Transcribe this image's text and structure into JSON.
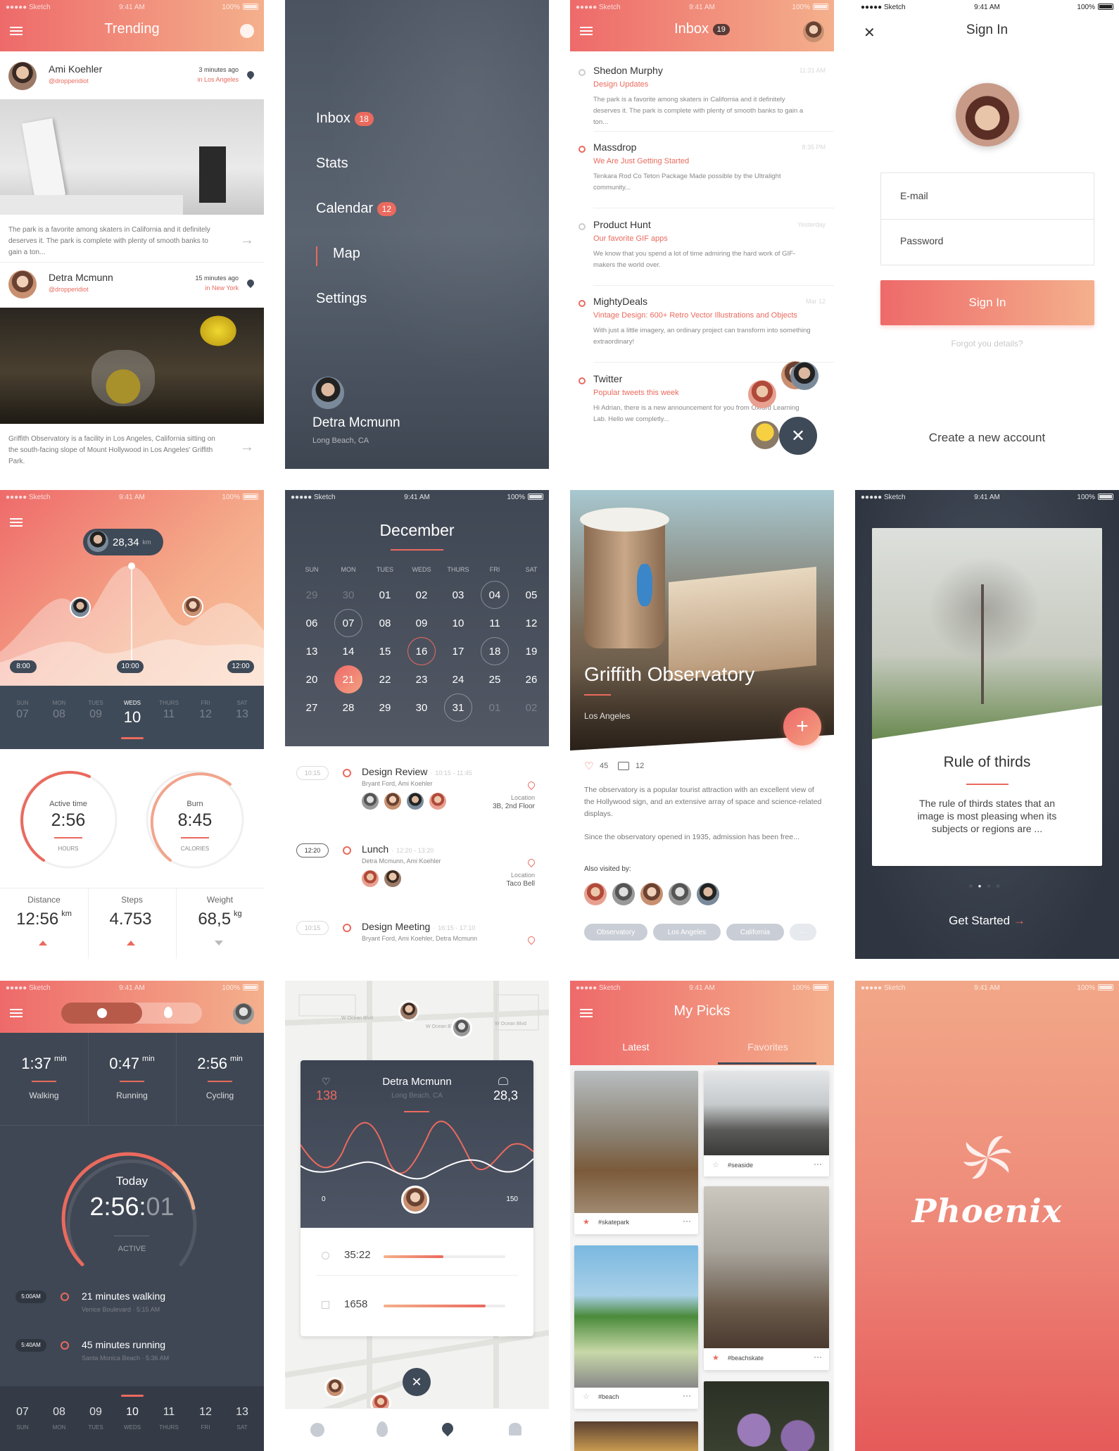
{
  "status": {
    "carrier": "●●●●● Sketch",
    "time": "9:41 AM",
    "battery": "100%"
  },
  "trending": {
    "title": "Trending",
    "posts": [
      {
        "name": "Ami Koehler",
        "handle": "@dropperidiot",
        "time": "3 minutes ago",
        "location": "in Los Angeles",
        "text": "The park is a favorite among skaters in California and it definitely deserves it. The park is complete with plenty of smooth banks to gain a ton..."
      },
      {
        "name": "Detra Mcmunn",
        "handle": "@dropperidiot",
        "time": "15 minutes ago",
        "location": "in New York",
        "text": "Griffith Observatory is a facility in Los Angeles, California sitting on the south-facing slope of Mount Hollywood in Los Angeles' Griffith Park."
      }
    ]
  },
  "menu": {
    "items": [
      {
        "label": "Inbox",
        "badge": "18"
      },
      {
        "label": "Stats",
        "badge": ""
      },
      {
        "label": "Calendar",
        "badge": "12"
      },
      {
        "label": "Map",
        "badge": ""
      },
      {
        "label": "Settings",
        "badge": ""
      }
    ],
    "user_name": "Detra Mcmunn",
    "user_location": "Long Beach, CA"
  },
  "inbox": {
    "title": "Inbox",
    "badge": "19",
    "messages": [
      {
        "sender": "Shedon Murphy",
        "time": "11:31 AM",
        "subject": "Design Updates",
        "preview": "The park is a favorite among skaters in California and it definitely deserves it. The park is complete with plenty of smooth banks to gain a ton..."
      },
      {
        "sender": "Massdrop",
        "time": "8:35 PM",
        "subject": "We Are Just Getting Started",
        "preview": "Tenkara Rod Co Teton Package Made possible by the Ultralight community..."
      },
      {
        "sender": "Product Hunt",
        "time": "Yesterday",
        "subject": "Our favorite GIF apps",
        "preview": "We know that you spend a lot of time admiring the hard work of GIF-makers the world over."
      },
      {
        "sender": "MightyDeals",
        "time": "Mar 12",
        "subject": "Vintage Design: 600+ Retro Vector Illustrations and Objects",
        "preview": "With just a little imagery, an ordinary project can transform into something extraordinary!"
      },
      {
        "sender": "Twitter",
        "time": "",
        "subject": "Popular tweets this week",
        "preview": "Hi Adrian, there is a new announcement for you from Oxford Learning  Lab. Hello we completly..."
      }
    ]
  },
  "signin": {
    "title": "Sign In",
    "email_placeholder": "E-mail",
    "password_placeholder": "Password",
    "button": "Sign In",
    "forgot": "Forgot you details?",
    "create": "Create a new account"
  },
  "activity": {
    "bubble_value": "28,34",
    "bubble_unit": "km",
    "time_labels": [
      "8:00",
      "10:00",
      "12:00"
    ],
    "days": [
      {
        "name": "SUN",
        "num": "07"
      },
      {
        "name": "MON",
        "num": "08"
      },
      {
        "name": "TUES",
        "num": "09"
      },
      {
        "name": "WEDS",
        "num": "10"
      },
      {
        "name": "THURS",
        "num": "11"
      },
      {
        "name": "FRI",
        "num": "12"
      },
      {
        "name": "SAT",
        "num": "13"
      }
    ],
    "active_time_label": "Active time",
    "active_time": "2:56",
    "active_time_unit": "HOURS",
    "burn_label": "Burn",
    "burn": "8:45",
    "burn_unit": "CALORIES",
    "stats": [
      {
        "label": "Distance",
        "value": "12:56",
        "unit": "km"
      },
      {
        "label": "Steps",
        "value": "4.753",
        "unit": ""
      },
      {
        "label": "Weight",
        "value": "68,5",
        "unit": "kg"
      }
    ]
  },
  "calendar": {
    "month": "December",
    "weekdays": [
      "SUN",
      "MON",
      "TUES",
      "WEDS",
      "THURS",
      "FRI",
      "SAT"
    ],
    "weeks": [
      [
        "29",
        "30",
        "01",
        "02",
        "03",
        "04",
        "05"
      ],
      [
        "06",
        "07",
        "08",
        "09",
        "10",
        "11",
        "12"
      ],
      [
        "13",
        "14",
        "15",
        "16",
        "17",
        "18",
        "19"
      ],
      [
        "20",
        "21",
        "22",
        "23",
        "24",
        "25",
        "26"
      ],
      [
        "27",
        "28",
        "29",
        "30",
        "31",
        "01",
        "02"
      ]
    ],
    "events": [
      {
        "time": "10:15",
        "title": "Design Review",
        "range": "10:15 - 11:45",
        "people": "Bryant Ford, Ami Koehler",
        "loc_label": "Location",
        "loc": "3B, 2nd Floor"
      },
      {
        "time": "12:20",
        "title": "Lunch",
        "range": "12:20 - 13:20",
        "people": "Detra Mcmunn, Ami Koehler",
        "loc_label": "Location",
        "loc": "Taco Bell"
      },
      {
        "time": "10:15",
        "title": "Design Meeting",
        "range": "16:15 - 17:10",
        "people": "Bryant Ford, Ami Koehler, Detra Mcmunn",
        "loc_label": "",
        "loc": ""
      }
    ]
  },
  "place": {
    "title": "Griffith Observatory",
    "subtitle": "Los Angeles",
    "likes": "45",
    "comments": "12",
    "desc1": "The observatory is a popular tourist attraction with an excellent view of the Hollywood sign, and an extensive array of space and science-related displays.",
    "desc2": "Since the observatory opened in 1935, admission has been free...",
    "visited_label": "Also visited by:",
    "tags": [
      "Observatory",
      "Los Angeles",
      "California",
      "···"
    ]
  },
  "onboarding": {
    "title": "Rule of thirds",
    "text": "The rule of thirds states that an image is most pleasing when its subjects or regions are ...",
    "cta": "Get Started"
  },
  "timer": {
    "stats": [
      {
        "value": "1:37",
        "unit": "min",
        "label": "Walking"
      },
      {
        "value": "0:47",
        "unit": "min",
        "label": "Running"
      },
      {
        "value": "2:56",
        "unit": "min",
        "label": "Cycling"
      }
    ],
    "today": "Today",
    "time_main": "2:56:",
    "time_sec": "01",
    "active": "ACTIVE",
    "timeline": [
      {
        "time": "5:00AM",
        "title": "21 minutes walking",
        "sub": "Venice Boulevard  ·  5:15 AM"
      },
      {
        "time": "5:40AM",
        "title": "45 minutes running",
        "sub": "Santa Monica Beach  ·  5:36 AM"
      }
    ],
    "days": [
      {
        "num": "07",
        "name": "SUN"
      },
      {
        "num": "08",
        "name": "MON"
      },
      {
        "num": "09",
        "name": "TUES"
      },
      {
        "num": "10",
        "name": "WEDS"
      },
      {
        "num": "11",
        "name": "THURS"
      },
      {
        "num": "12",
        "name": "FRI"
      },
      {
        "num": "13",
        "name": "SAT"
      }
    ]
  },
  "mapcard": {
    "name": "Detra Mcmunn",
    "location": "Long Beach, CA",
    "left_value": "138",
    "right_value": "28,3",
    "axis_min": "0",
    "axis_max": "150",
    "rows": [
      {
        "value": "35:22",
        "progress": 0.49
      },
      {
        "value": "1658",
        "progress": 0.84
      }
    ],
    "streets": [
      "W Ocean Blvd",
      "W Ocean Blvd",
      "W Ocean Blvd"
    ]
  },
  "picks": {
    "title": "My Picks",
    "tabs": [
      "Latest",
      "Favorites"
    ],
    "items": [
      {
        "tag": "#skatepark"
      },
      {
        "tag": "#seaside"
      },
      {
        "tag": "#beach"
      },
      {
        "tag": "#beachskate"
      }
    ]
  },
  "splash": {
    "brand": "Phoenix"
  }
}
